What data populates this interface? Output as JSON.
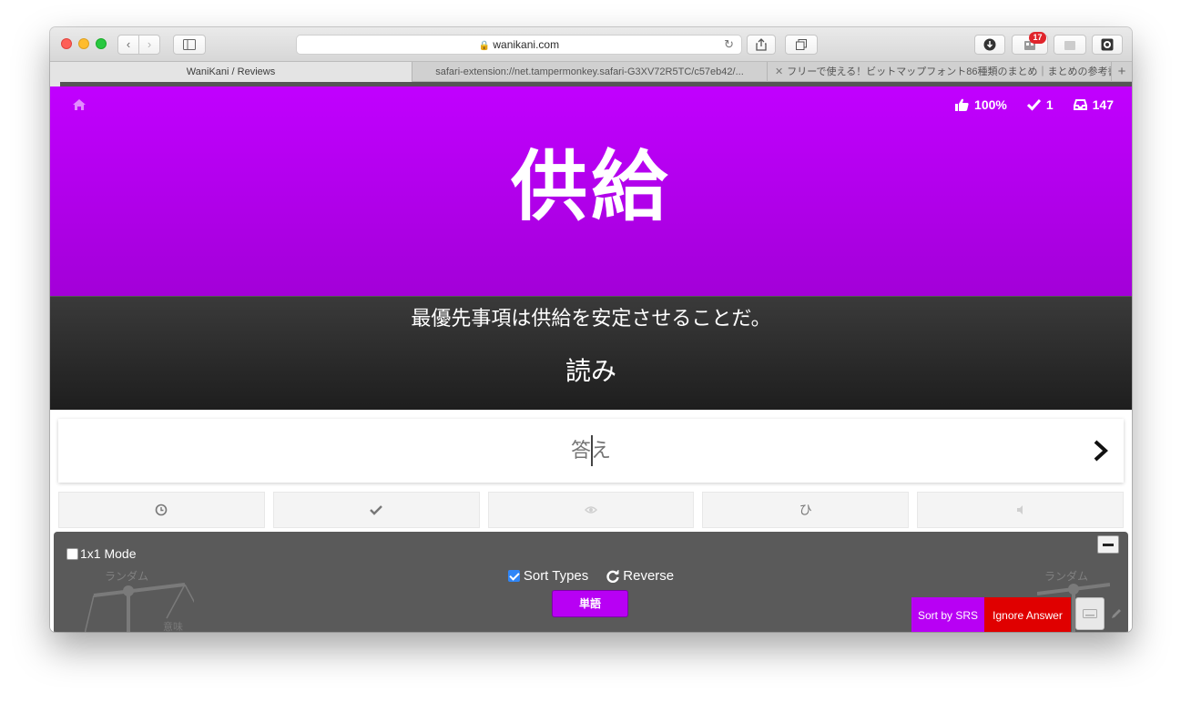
{
  "browser": {
    "address": "wanikani.com",
    "notification_count": "17",
    "tabs": [
      {
        "label": "WaniKani / Reviews"
      },
      {
        "label": "safari-extension://net.tampermonkey.safari-G3XV72R5TC/c57eb42/..."
      },
      {
        "label": "フリーで使える！ビットマップフォント86種類のまとめ｜まとめの参考書 [site..."
      }
    ]
  },
  "review": {
    "accuracy": "100%",
    "completed": "1",
    "remaining": "147",
    "character": "供給",
    "sentence": "最優先事項は供給を安定させることだ。",
    "question_type": "読み",
    "answer_placeholder": "答え",
    "info_buttons": [
      {
        "icon": "clock-icon"
      },
      {
        "icon": "check-icon"
      },
      {
        "icon": "eye-icon",
        "disabled": true
      },
      {
        "icon": "kana-icon",
        "label": "ひ"
      },
      {
        "icon": "audio-icon",
        "disabled": true
      }
    ]
  },
  "panel": {
    "mode_label": "1x1 Mode",
    "mode_checked": false,
    "sort_types_label": "Sort Types",
    "sort_types_checked": true,
    "reverse_label": "Reverse",
    "type_button": "単語",
    "random_label_left": "ランダム",
    "random_label_right": "ランダム",
    "scale_label": "意味",
    "sort_srs_label": "Sort by SRS",
    "ignore_answer_label": "Ignore Answer"
  },
  "colors": {
    "vocabulary_purple": "#c100ff",
    "ignore_red": "#e00000",
    "checkbox_blue": "#2f86f7"
  }
}
